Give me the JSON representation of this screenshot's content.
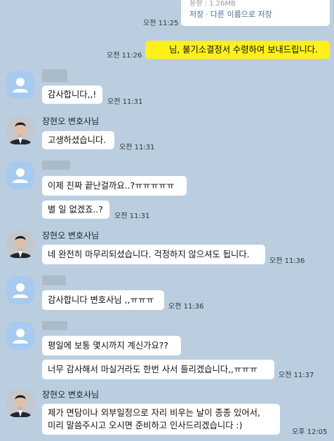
{
  "file": {
    "size": "용량 : 1.26MB",
    "save": "저장",
    "separator": "·",
    "save_as": "다른 이름으로 저장",
    "time": "오전 11:25"
  },
  "messages": [
    {
      "id": "m1",
      "text": "님, 불기소결정서 수령하여 보내드립니다.",
      "time": "오전 11:26"
    },
    {
      "id": "m2",
      "text": "감사합니다,,!",
      "time": "오전 11:31"
    },
    {
      "id": "m3",
      "sender": "장현오 변호사님",
      "text": "고생하셨습니다.",
      "time": "오전 11:31"
    },
    {
      "id": "m4a",
      "text": "이제 진짜 끝난걸까요..?ㅠㅠㅠㅠㅠ"
    },
    {
      "id": "m4b",
      "text": "별 일 없겠죠..?",
      "time": "오전 11:31"
    },
    {
      "id": "m5",
      "sender": "장현오 변호사님",
      "text": "네 완전히 마무리되셨습니다. 걱정하지 않으셔도 됩니다.",
      "time": "오전 11:36"
    },
    {
      "id": "m6",
      "text": "감사합니다 변호사님 ,,ㅠㅠㅠ",
      "time": "오전 11:36"
    },
    {
      "id": "m7a",
      "text": "평일에 보통 몇시까지 계신가요??"
    },
    {
      "id": "m7b",
      "text": "너무 감사해서 마실거라도 한번 사서 들리겠습니다,,ㅠㅠㅠ",
      "time": "오전 11:37"
    },
    {
      "id": "m8",
      "sender": "장현오 변호사님",
      "lines": [
        "제가 면담이나 외부일정으로 자리 비우는 날이 종종 있어서,",
        "미리 말씀주시고 오시면 준비하고 인사드리겠습니다 :)"
      ],
      "time": "오후 12:05"
    }
  ],
  "colors": {
    "background": "#bacee0",
    "my_bubble": "#fef01b",
    "other_bubble": "#ffffff",
    "default_avatar": "#a6caf0"
  }
}
